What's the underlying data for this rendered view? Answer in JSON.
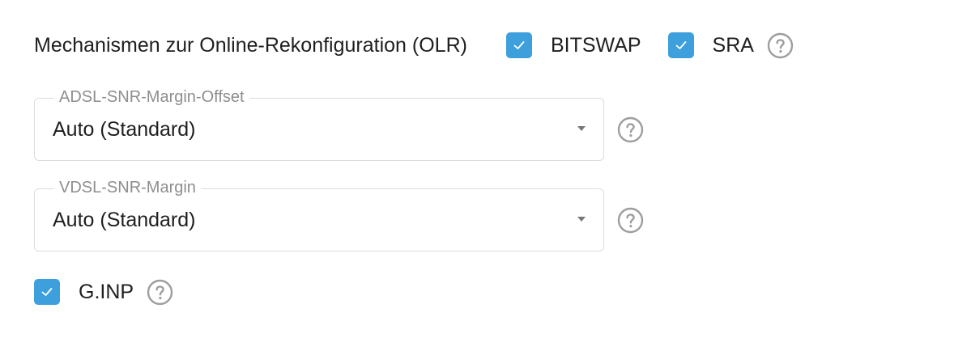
{
  "olr": {
    "label": "Mechanismen zur Online-Rekonfiguration (OLR)",
    "options": [
      {
        "label": "BITSWAP",
        "checked": true
      },
      {
        "label": "SRA",
        "checked": true
      }
    ]
  },
  "adsl": {
    "legend": "ADSL-SNR-Margin-Offset",
    "value": "Auto (Standard)"
  },
  "vdsl": {
    "legend": "VDSL-SNR-Margin",
    "value": "Auto (Standard)"
  },
  "ginp": {
    "label": "G.INP",
    "checked": true
  },
  "colors": {
    "accent": "#3d9fdb",
    "help_icon": "#9e9e9e",
    "field_border": "#dcdcdc",
    "legend_text": "#8e8e8e"
  },
  "icons": {
    "checkbox": "check-icon",
    "help": "help-circle-icon",
    "dropdown": "chevron-down-icon"
  }
}
